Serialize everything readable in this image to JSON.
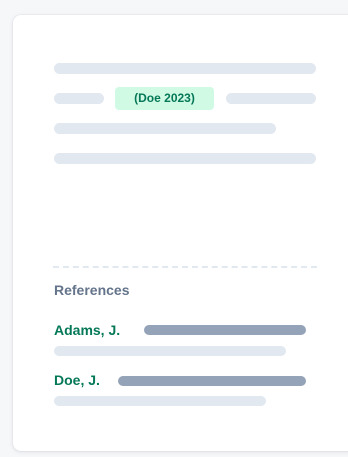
{
  "citation": {
    "text": "(Doe 2023)"
  },
  "references": {
    "heading": "References",
    "entries": [
      {
        "author": "Adams, J."
      },
      {
        "author": "Doe, J."
      }
    ]
  },
  "colors": {
    "citation_bg": "#d1fae5",
    "citation_text": "#047857",
    "placeholder_light": "#e2e8f0",
    "placeholder_dark": "#94a3b8",
    "heading_text": "#64748b"
  }
}
